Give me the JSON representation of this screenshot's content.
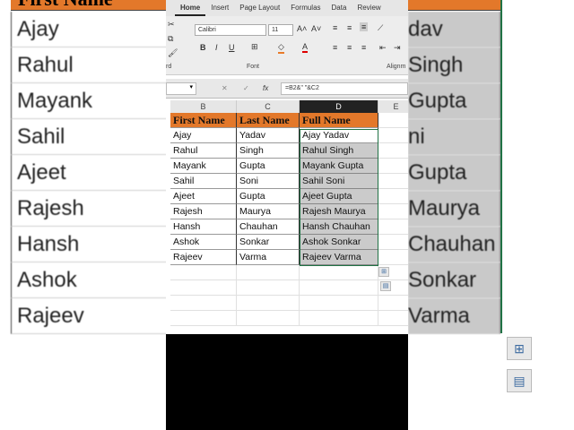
{
  "ribbon": {
    "tabs": [
      "Home",
      "Insert",
      "Page Layout",
      "Formulas",
      "Data",
      "Review"
    ],
    "active_tab": "Home",
    "font_name": "Calibri",
    "font_size": "11",
    "groups": {
      "clipboard": "rd",
      "font": "Font",
      "alignment": "Alignm"
    }
  },
  "formula_bar": {
    "formula": "=B2&\" \"&C2",
    "fx": "fx"
  },
  "columns": [
    "B",
    "C",
    "D",
    "E"
  ],
  "selected_column": "D",
  "headers": [
    "First Name",
    "Last Name",
    "Full Name"
  ],
  "rows": [
    [
      "Ajay",
      "Yadav",
      "Ajay Yadav"
    ],
    [
      "Rahul",
      "Singh",
      "Rahul  Singh"
    ],
    [
      "Mayank",
      "Gupta",
      "Mayank  Gupta"
    ],
    [
      "Sahil",
      "Soni",
      "Sahil  Soni"
    ],
    [
      "Ajeet",
      "Gupta",
      "Ajeet Gupta"
    ],
    [
      "Rajesh",
      "Maurya",
      "Rajesh Maurya"
    ],
    [
      "Hansh",
      "Chauhan",
      "Hansh Chauhan"
    ],
    [
      "Ashok",
      "Sonkar",
      "Ashok  Sonkar"
    ],
    [
      "Rajeev",
      "Varma",
      "Rajeev Varma"
    ]
  ],
  "background_left": [
    "Ajay",
    "Rahul",
    "Mayank",
    "Sahil",
    "Ajeet",
    "Rajesh",
    "Hansh",
    "Ashok",
    "Rajeev"
  ],
  "background_right": [
    "dav",
    "Singh",
    "  Gupta",
    "ni",
    "Gupta",
    "Maurya",
    "Chauhan",
    "Sonkar",
    "Varma"
  ],
  "background_header": "First Name"
}
